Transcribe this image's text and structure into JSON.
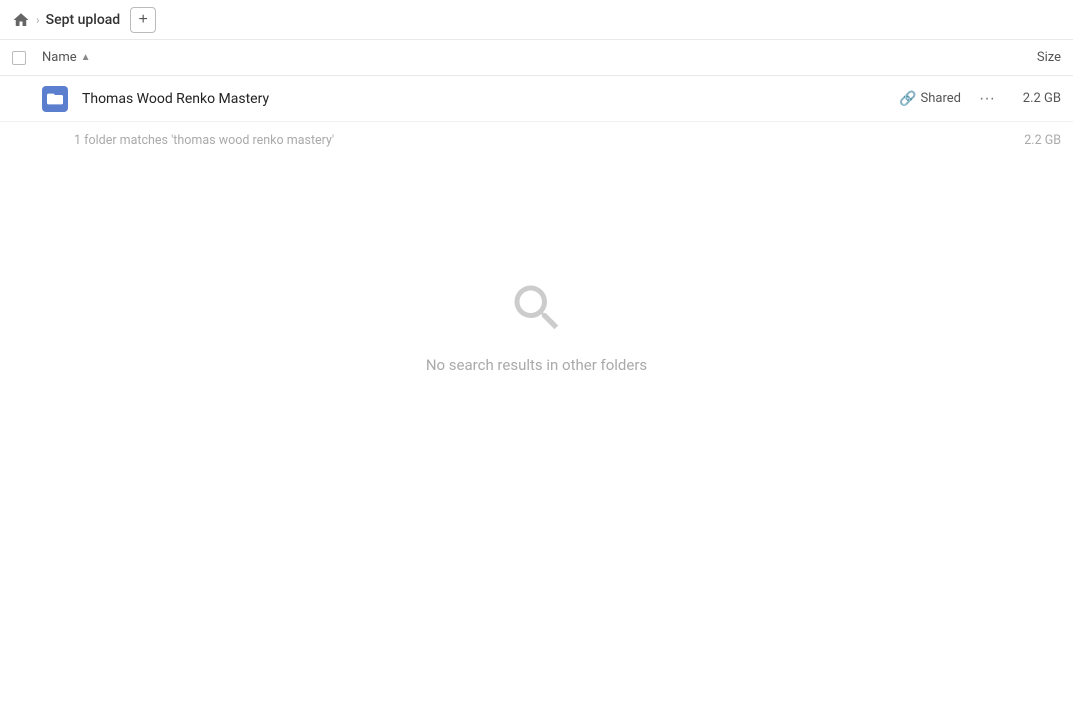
{
  "breadcrumb": {
    "home_label": "home",
    "folder_name": "Sept upload",
    "add_button_label": "+"
  },
  "columns": {
    "name_label": "Name",
    "sort_indicator": "▲",
    "size_label": "Size"
  },
  "file_row": {
    "name": "Thomas Wood Renko Mastery",
    "shared_label": "Shared",
    "more_label": "···",
    "size": "2.2 GB"
  },
  "summary": {
    "text": "1 folder matches 'thomas wood renko mastery'",
    "size": "2.2 GB"
  },
  "empty_state": {
    "message": "No search results in other folders"
  }
}
